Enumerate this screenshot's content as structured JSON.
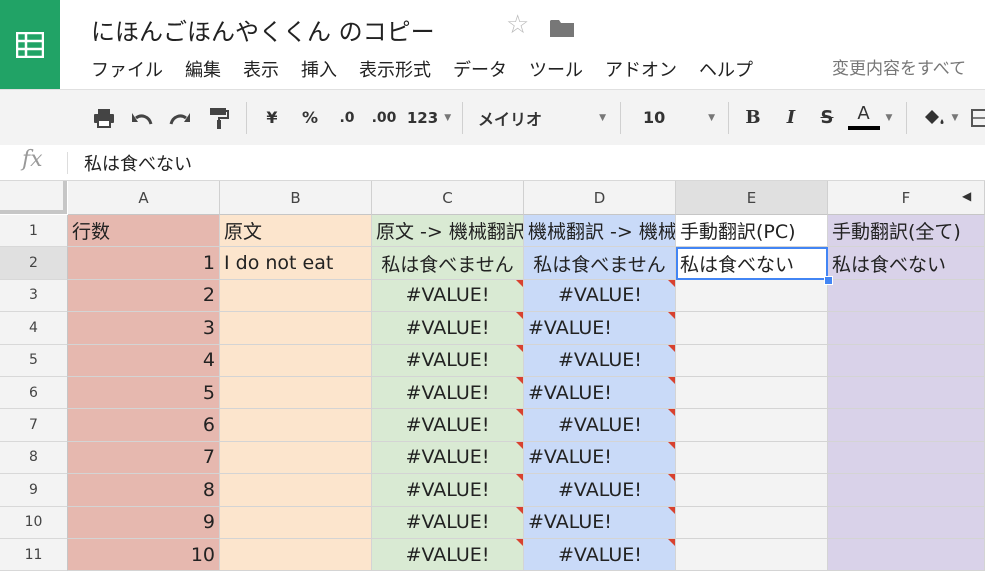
{
  "doc": {
    "title": "にほんごほんやくくん のコピー"
  },
  "menu": [
    "ファイル",
    "編集",
    "表示",
    "挿入",
    "表示形式",
    "データ",
    "ツール",
    "アドオン",
    "ヘルプ"
  ],
  "changes_text": "変更内容をすべて",
  "toolbar": {
    "currency": "¥",
    "percent": "%",
    "dec_less": ".0",
    "dec_more": ".00",
    "format_more": "123",
    "font": "メイリオ",
    "font_size": "10",
    "bold": "B",
    "italic": "I",
    "strike": "S",
    "text_color": "A"
  },
  "formula_bar": {
    "fx": "fx",
    "value": "私は食べない"
  },
  "columns": [
    "A",
    "B",
    "C",
    "D",
    "E",
    "F"
  ],
  "rows": [
    {
      "n": "1",
      "A": "行数",
      "B": "原文",
      "C": "原文 -> 機械翻訳",
      "D": "機械翻訳 -> 機械",
      "E": "手動翻訳(PC)",
      "F": "手動翻訳(全て)"
    },
    {
      "n": "2",
      "A": "1",
      "B": "I do not eat",
      "C": "私は食べません",
      "D": "私は食べません",
      "E": "私は食べない",
      "F": "私は食べない"
    },
    {
      "n": "3",
      "A": "2",
      "B": "",
      "C": "#VALUE!",
      "D": "#VALUE!",
      "E": "",
      "F": ""
    },
    {
      "n": "4",
      "A": "3",
      "B": "",
      "C": "#VALUE!",
      "D": "#VALUE!",
      "E": "",
      "F": ""
    },
    {
      "n": "5",
      "A": "4",
      "B": "",
      "C": "#VALUE!",
      "D": "#VALUE!",
      "E": "",
      "F": ""
    },
    {
      "n": "6",
      "A": "5",
      "B": "",
      "C": "#VALUE!",
      "D": "#VALUE!",
      "E": "",
      "F": ""
    },
    {
      "n": "7",
      "A": "6",
      "B": "",
      "C": "#VALUE!",
      "D": "#VALUE!",
      "E": "",
      "F": ""
    },
    {
      "n": "8",
      "A": "7",
      "B": "",
      "C": "#VALUE!",
      "D": "#VALUE!",
      "E": "",
      "F": ""
    },
    {
      "n": "9",
      "A": "8",
      "B": "",
      "C": "#VALUE!",
      "D": "#VALUE!",
      "E": "",
      "F": ""
    },
    {
      "n": "10",
      "A": "9",
      "B": "",
      "C": "#VALUE!",
      "D": "#VALUE!",
      "E": "",
      "F": ""
    },
    {
      "n": "11",
      "A": "10",
      "B": "",
      "C": "#VALUE!",
      "D": "#VALUE!",
      "E": "",
      "F": ""
    }
  ],
  "colors": {
    "col_A": "#e6b8af",
    "col_B": "#fce5cd",
    "col_C": "#d9ead3",
    "col_D": "#c9daf8",
    "col_E": "#f3f3f3",
    "col_F": "#d9d2e9",
    "selection": "#4285f4",
    "error_marker": "#d8412f"
  },
  "selected_cell": "E2"
}
